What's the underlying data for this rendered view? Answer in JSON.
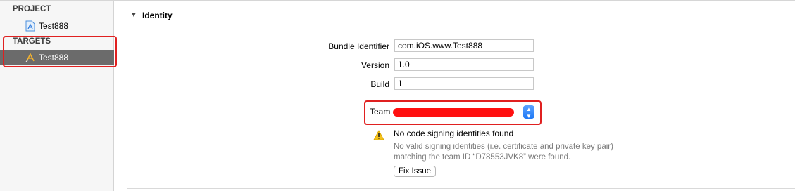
{
  "sidebar": {
    "project_header": "PROJECT",
    "project_item": "Test888",
    "targets_header": "TARGETS",
    "target_item": "Test888"
  },
  "identity": {
    "section_title": "Identity",
    "bundle_identifier_label": "Bundle Identifier",
    "bundle_identifier_value": "com.iOS.www.Test888",
    "version_label": "Version",
    "version_value": "1.0",
    "build_label": "Build",
    "build_value": "1",
    "team_label": "Team"
  },
  "warning": {
    "title": "No code signing identities found",
    "description": "No valid signing identities (i.e. certificate and private key pair) matching the team ID “D78553JVK8” were found.",
    "fix_button": "Fix Issue"
  },
  "colors": {
    "annotation_red": "#e02020",
    "selected_row": "#6b6b6b",
    "stepper_blue": "#1f78f5"
  }
}
